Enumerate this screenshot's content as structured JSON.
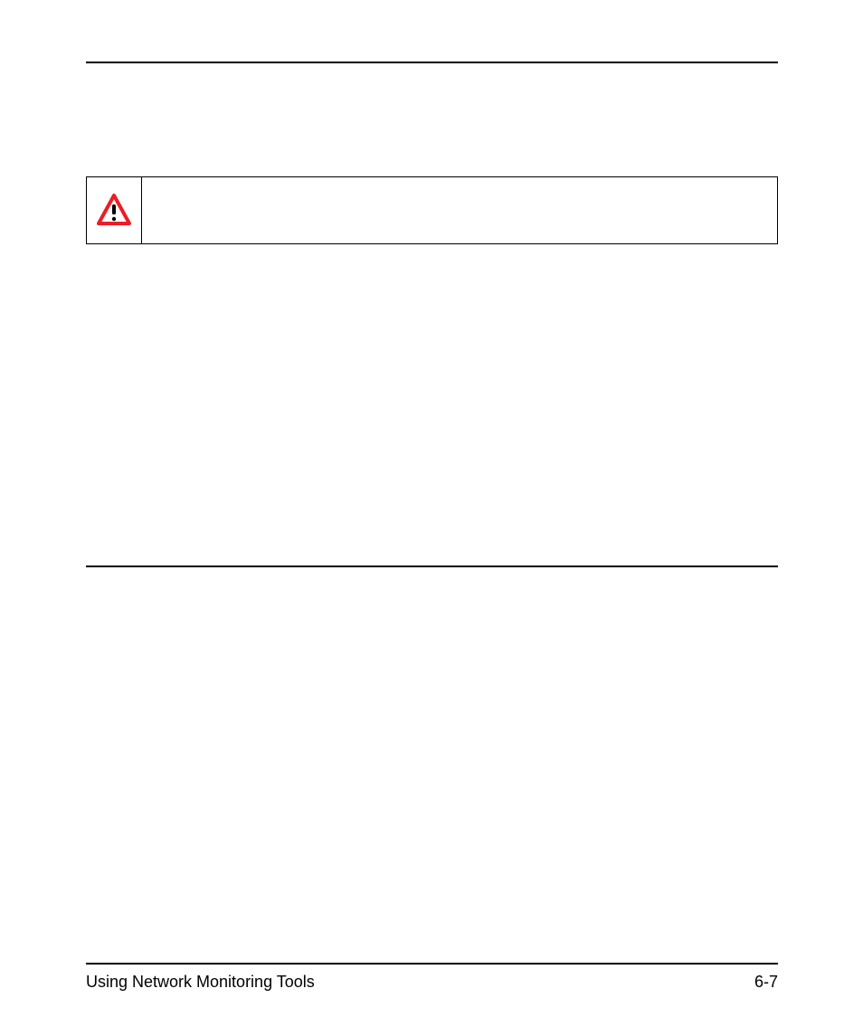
{
  "icons": {
    "warning": "warning-triangle"
  },
  "footer": {
    "left": "Using Network Monitoring Tools",
    "right": "6-7"
  }
}
